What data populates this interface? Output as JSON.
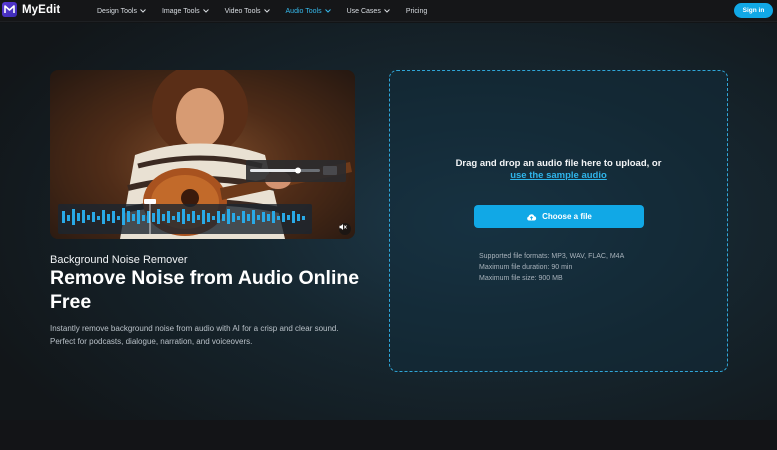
{
  "header": {
    "brand": "MyEdit",
    "nav": [
      {
        "label": "Design Tools",
        "dropdown": true,
        "active": false
      },
      {
        "label": "Image Tools",
        "dropdown": true,
        "active": false
      },
      {
        "label": "Video Tools",
        "dropdown": true,
        "active": false
      },
      {
        "label": "Audio Tools",
        "dropdown": true,
        "active": true
      },
      {
        "label": "Use Cases",
        "dropdown": true,
        "active": false
      },
      {
        "label": "Pricing",
        "dropdown": false,
        "active": false
      }
    ],
    "signin_label": "Sign in"
  },
  "hero": {
    "subtitle": "Background Noise Remover",
    "title": "Remove Noise from Audio Online Free",
    "description": "Instantly remove background noise from audio with AI for a crisp and clear sound. Perfect for podcasts, dialogue, narration, and voiceovers."
  },
  "upload": {
    "prompt": "Drag and drop an audio file here to upload, or",
    "sample_link": "use the sample audio",
    "button_label": "Choose a file",
    "formats": "Supported file formats: MP3, WAV, FLAC, M4A",
    "duration": "Maximum file duration: 90 min",
    "size": "Maximum file size: 900 MB"
  },
  "colors": {
    "accent": "#11a8e6",
    "link": "#2fb4ea",
    "active_nav": "#36b9ec",
    "background": "#121416"
  },
  "icons": {
    "brand": "myedit-logo-icon",
    "nav_dropdown": "chevron-down-icon",
    "upload": "cloud-upload-icon",
    "video_mute": "speaker-muted-icon"
  }
}
